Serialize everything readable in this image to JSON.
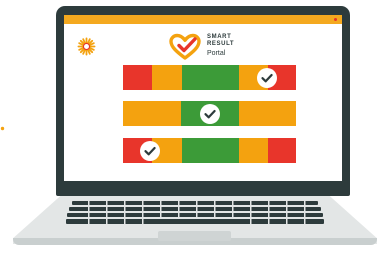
{
  "brand": {
    "line1": "SMART",
    "line2": "RESULT",
    "line3": "Portal"
  },
  "icons": {
    "logo": "heart-check-logo-icon",
    "corner": "sunburst-icon",
    "check": "check-circle-icon"
  },
  "colors": {
    "red": "#e8352b",
    "orange": "#f4a20f",
    "green": "#3c9b38",
    "laptop_frame": "#2d3b3c",
    "title_strip": "#f4a91f"
  },
  "result_bars": [
    {
      "segments": [
        "red",
        "orange",
        "green",
        "orange",
        "red"
      ],
      "checked_segment": "orange"
    },
    {
      "segments": [
        "orange",
        "green",
        "orange"
      ],
      "checked_segment": "green"
    },
    {
      "segments": [
        "red",
        "orange",
        "green",
        "orange",
        "red"
      ],
      "checked_segment": "red"
    }
  ]
}
